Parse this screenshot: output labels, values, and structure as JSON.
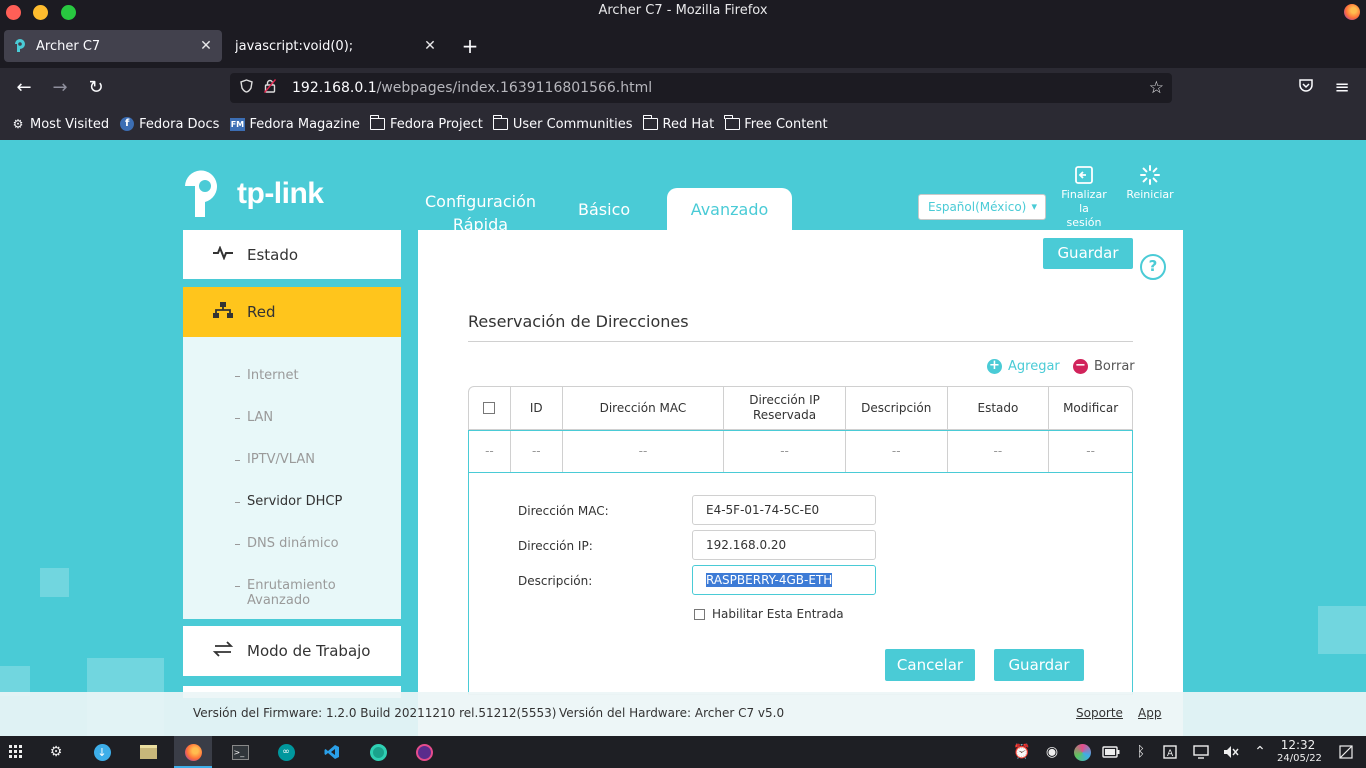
{
  "window": {
    "title": "Archer C7 - Mozilla Firefox"
  },
  "tabs": [
    {
      "label": "Archer C7",
      "icon": "tplink-icon"
    },
    {
      "label": "javascript:void(0);"
    }
  ],
  "urlbar": {
    "host": "192.168.0.1",
    "path": "/webpages/index.1639116801566.html"
  },
  "bookmarks": [
    {
      "label": "Most Visited",
      "icon": "gear-icon"
    },
    {
      "label": "Fedora Docs",
      "icon": "fedora-icon"
    },
    {
      "label": "Fedora Magazine",
      "icon": "fm-icon"
    },
    {
      "label": "Fedora Project",
      "icon": "folder-icon"
    },
    {
      "label": "User Communities",
      "icon": "folder-icon"
    },
    {
      "label": "Red Hat",
      "icon": "folder-icon"
    },
    {
      "label": "Free Content",
      "icon": "folder-icon"
    }
  ],
  "router": {
    "logo_text": "tp-link",
    "nav_tabs": {
      "quick": "Configuración Rápida",
      "basic": "Básico",
      "advanced": "Avanzado"
    },
    "language": "Español(México)",
    "logout_label": "Finalizar la sesión",
    "reboot_label": "Reiniciar",
    "sidebar": {
      "estado": "Estado",
      "red": "Red",
      "sub_items": [
        "Internet",
        "LAN",
        "IPTV/VLAN",
        "Servidor DHCP",
        "DNS dinámico",
        "Enrutamiento Avanzado"
      ],
      "active_sub": "Servidor DHCP",
      "modo": "Modo de Trabajo"
    },
    "content": {
      "save_top": "Guardar",
      "help": "?",
      "section_title": "Reservación de Direcciones",
      "add_label": "Agregar",
      "delete_label": "Borrar",
      "table": {
        "headers": [
          "ID",
          "Dirección MAC",
          "Dirección IP Reservada",
          "Descripción",
          "Estado",
          "Modificar"
        ],
        "row": [
          "--",
          "--",
          "--",
          "--",
          "--",
          "--",
          "--"
        ]
      },
      "form": {
        "mac_label": "Dirección MAC:",
        "mac_value": "E4-5F-01-74-5C-E0",
        "ip_label": "Dirección IP:",
        "ip_value": "192.168.0.20",
        "desc_label": "Descripción:",
        "desc_value": "RASPBERRY-4GB-ETH",
        "enable_label": "Habilitar Esta Entrada",
        "cancel": "Cancelar",
        "save": "Guardar"
      }
    },
    "footer": {
      "firmware": "Versión del Firmware: 1.2.0 Build 20211210 rel.51212(5553)",
      "hardware": "Versión del Hardware: Archer C7 v5.0",
      "support": "Soporte",
      "app": "App"
    }
  },
  "taskbar": {
    "time": "12:32",
    "date": "24/05/22"
  },
  "colors": {
    "accent": "#4acbd6",
    "active_menu": "#ffc51c",
    "delete": "#d1235b"
  }
}
